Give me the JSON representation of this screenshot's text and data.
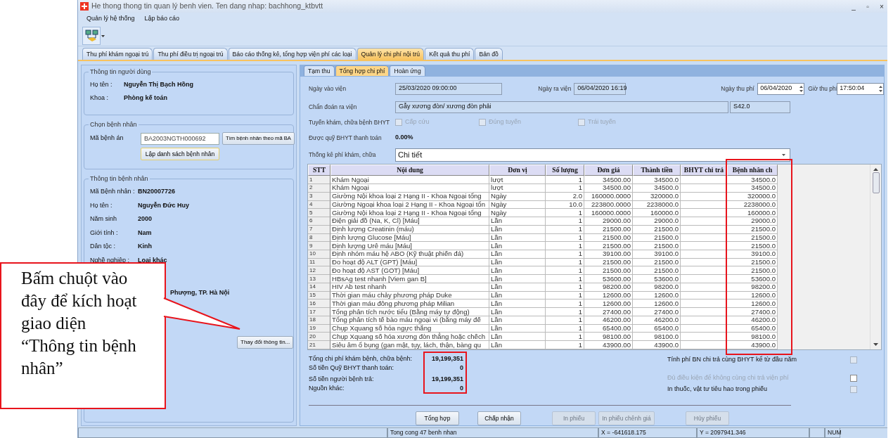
{
  "window": {
    "title": "He thong thong tin quan lý benh vien. Ten dang nhap: bachhong_ktbvtt",
    "controls": [
      "_",
      "▫",
      "×"
    ]
  },
  "menu": [
    "Quản lý hệ thống",
    "Lập báo cáo"
  ],
  "main_tabs": [
    {
      "label": "Thu phí khám ngoại trú",
      "selected": false
    },
    {
      "label": "Thu phí điều trị ngoại trú",
      "selected": false
    },
    {
      "label": "Báo cáo thống kê, tổng hợp viện phí các loại",
      "selected": false
    },
    {
      "label": "Quản lý chi phí nội trú",
      "selected": true
    },
    {
      "label": "Kết quả thu phí",
      "selected": false
    },
    {
      "label": "Bản đồ",
      "selected": false
    }
  ],
  "user_info": {
    "legend": "Thông tin người dùng",
    "rows": [
      {
        "label": "Họ tên :",
        "value": "Nguyễn Thị Bạch Hồng"
      },
      {
        "label": "Khoa :",
        "value": "Phòng kế toán"
      }
    ]
  },
  "choose_patient": {
    "legend": "Chọn bệnh nhân",
    "label": "Mã bệnh án",
    "value": "BA2003NGTH000692",
    "find_button": "Tìm bệnh nhân theo mã BA",
    "list_button": "Lập danh sách bệnh nhân"
  },
  "patient_info": {
    "legend": "Thông tin bệnh nhân",
    "rows": [
      {
        "label": "Mã Bệnh nhân :",
        "value": "BN20007726"
      },
      {
        "label": "Họ tên :",
        "value": "Nguyễn Đức Huy"
      },
      {
        "label": "Năm sinh",
        "value": "2000"
      },
      {
        "label": "Giới tính :",
        "value": "Nam"
      },
      {
        "label": "Dân tộc :",
        "value": "Kinh"
      },
      {
        "label": "Nghề nghiệp :",
        "value": "Loại khác"
      }
    ],
    "address_part": "Phượng, TP. Hà Nội",
    "change_button": "Thay đổi thông tin..."
  },
  "sub_tabs": [
    {
      "label": "Tạm thu",
      "selected": false
    },
    {
      "label": "Tổng hợp chi phí",
      "selected": true
    },
    {
      "label": "Hoàn ứng",
      "selected": false
    }
  ],
  "form": {
    "admit_label": "Ngày vào viện",
    "admit_value": "25/03/2020 09:00:00",
    "discharge_label": "Ngày ra viện",
    "discharge_value": "06/04/2020 16:19",
    "fee_date_label": "Ngày thu phí",
    "fee_date_value": "06/04/2020",
    "fee_time_label": "Giờ thu phí",
    "fee_time_value": "17:50:04",
    "diagnosis_label": "Chẩn đoán ra viện",
    "diagnosis_value": "Gẫy xương đòn/ xương đòn phải",
    "diagnosis_code": "S42.0",
    "route_label": "Tuyến khám, chữa bệnh BHYT",
    "route_options": [
      {
        "label": "Cấp cứu",
        "checked": false,
        "disabled": true
      },
      {
        "label": "Đúng tuyến",
        "checked": false,
        "disabled": true
      },
      {
        "label": "Trái tuyến",
        "checked": false,
        "disabled": true
      }
    ],
    "coverage_label": "Được quỹ BHYT thanh toán",
    "coverage_value": "0.00%",
    "stats_label": "Thống kê phí khám, chữa",
    "stats_value": "Chi tiết"
  },
  "table": {
    "columns": [
      "STT",
      "Nội dung",
      "Đơn vị",
      "Số lượng",
      "Đơn giá",
      "Thành tiền",
      "BHYT chi trả",
      "Bệnh nhân ch"
    ],
    "rows": [
      {
        "stt": "1",
        "content": "Khám Ngoại",
        "unit": "lượt",
        "qty": "1",
        "price": "34500.00",
        "amount": "34500.0",
        "patient": "34500.0"
      },
      {
        "stt": "2",
        "content": "Khám Ngoại",
        "unit": "lượt",
        "qty": "1",
        "price": "34500.00",
        "amount": "34500.0",
        "patient": "34500.0"
      },
      {
        "stt": "3",
        "content": "Giường Nội khoa loại 2 Hạng II - Khoa Ngoại tổng",
        "unit": "Ngày",
        "qty": "2.0",
        "price": "160000.0000",
        "amount": "320000.0",
        "patient": "320000.0"
      },
      {
        "stt": "4",
        "content": "Giường Ngoại khoa loại 2 Hạng II - Khoa Ngoại tổn",
        "unit": "Ngày",
        "qty": "10.0",
        "price": "223800.0000",
        "amount": "2238000.0",
        "patient": "2238000.0"
      },
      {
        "stt": "5",
        "content": "Giường Nội khoa loại 2 Hạng II - Khoa Ngoại tổng",
        "unit": "Ngày",
        "qty": "1",
        "price": "160000.0000",
        "amount": "160000.0",
        "patient": "160000.0"
      },
      {
        "stt": "6",
        "content": "Điện giải đồ (Na, K, Cl) [Máu]",
        "unit": "Lần",
        "qty": "1",
        "price": "29000.00",
        "amount": "29000.0",
        "patient": "29000.0"
      },
      {
        "stt": "7",
        "content": "Định lượng Creatinin (máu)",
        "unit": "Lần",
        "qty": "1",
        "price": "21500.00",
        "amount": "21500.0",
        "patient": "21500.0"
      },
      {
        "stt": "8",
        "content": "Định lượng Glucose [Máu]",
        "unit": "Lần",
        "qty": "1",
        "price": "21500.00",
        "amount": "21500.0",
        "patient": "21500.0"
      },
      {
        "stt": "9",
        "content": "Định lượng Urê máu [Máu]",
        "unit": "Lần",
        "qty": "1",
        "price": "21500.00",
        "amount": "21500.0",
        "patient": "21500.0"
      },
      {
        "stt": "10",
        "content": "Định nhóm máu hệ ABO (Kỹ thuật phiến đá)",
        "unit": "Lần",
        "qty": "1",
        "price": "39100.00",
        "amount": "39100.0",
        "patient": "39100.0"
      },
      {
        "stt": "11",
        "content": "Đo hoạt độ ALT (GPT) [Máu]",
        "unit": "Lần",
        "qty": "1",
        "price": "21500.00",
        "amount": "21500.0",
        "patient": "21500.0"
      },
      {
        "stt": "12",
        "content": "Đo hoạt độ AST (GOT) [Máu]",
        "unit": "Lần",
        "qty": "1",
        "price": "21500.00",
        "amount": "21500.0",
        "patient": "21500.0"
      },
      {
        "stt": "13",
        "content": "HBsAg test nhanh [Viem gan B]",
        "unit": "Lần",
        "qty": "1",
        "price": "53600.00",
        "amount": "53600.0",
        "patient": "53600.0"
      },
      {
        "stt": "14",
        "content": "HIV Ab test nhanh",
        "unit": "Lần",
        "qty": "1",
        "price": "98200.00",
        "amount": "98200.0",
        "patient": "98200.0"
      },
      {
        "stt": "15",
        "content": "Thời gian máu chảy phương pháp Duke",
        "unit": "Lần",
        "qty": "1",
        "price": "12600.00",
        "amount": "12600.0",
        "patient": "12600.0"
      },
      {
        "stt": "16",
        "content": "Thời gian máu đông phương pháp Milian",
        "unit": "Lần",
        "qty": "1",
        "price": "12600.00",
        "amount": "12600.0",
        "patient": "12600.0"
      },
      {
        "stt": "17",
        "content": "Tổng phân tích nước tiểu (Bằng máy tự động)",
        "unit": "Lần",
        "qty": "1",
        "price": "27400.00",
        "amount": "27400.0",
        "patient": "27400.0"
      },
      {
        "stt": "18",
        "content": "Tổng phân tích tế bào máu ngoại vi (bằng máy đế",
        "unit": "Lần",
        "qty": "1",
        "price": "46200.00",
        "amount": "46200.0",
        "patient": "46200.0"
      },
      {
        "stt": "19",
        "content": "Chụp Xquang số hóa ngực thẳng",
        "unit": "Lần",
        "qty": "1",
        "price": "65400.00",
        "amount": "65400.0",
        "patient": "65400.0"
      },
      {
        "stt": "20",
        "content": "Chụp Xquang số hóa xương đòn thẳng hoặc chếch",
        "unit": "Lần",
        "qty": "1",
        "price": "98100.00",
        "amount": "98100.0",
        "patient": "98100.0"
      },
      {
        "stt": "21",
        "content": "Siêu âm ổ bụng (gan mật, tụy, lách, thận, bàng qu",
        "unit": "Lần",
        "qty": "1",
        "price": "43900.00",
        "amount": "43900.0",
        "patient": "43900.0"
      }
    ]
  },
  "totals": [
    {
      "label": "Tổng chi phí khám bệnh, chữa bệnh:",
      "value": "19,199,351"
    },
    {
      "label": "Số tiền Quỹ BHYT thanh toán:",
      "value": "0"
    },
    {
      "label": "Số tiền người bệnh trả:",
      "value": "19,199,351"
    },
    {
      "label": "Nguồn khác:",
      "value": "0"
    }
  ],
  "options": [
    {
      "label": "Tính phí BN chi trả cùng BHYT kể từ đầu năm",
      "checked": false,
      "disabled": true
    },
    {
      "label": "Đủ điều kiện để không cùng chi trả viện phí",
      "checked": false,
      "disabled": false,
      "label_greyed": true
    },
    {
      "label": "In thuốc, vật tư tiêu hao trong phiếu",
      "checked": false,
      "disabled": true
    }
  ],
  "buttons": [
    {
      "label": "Tổng hợp",
      "disabled": false
    },
    {
      "label": "Chấp nhận",
      "disabled": false
    },
    {
      "label": "In phiếu",
      "disabled": true
    },
    {
      "label": "In phiếu chênh giá",
      "disabled": true
    },
    {
      "label": "Hủy phiếu",
      "disabled": true
    }
  ],
  "status_bar": [
    "Tong cong 47 benh nhan",
    "X = -641618.175",
    "Y = 2097941.346",
    "NUM"
  ],
  "callout": {
    "text": "Bấm chuột vào đây để kích hoạt giao diện “Thông tin bệnh nhân”"
  }
}
